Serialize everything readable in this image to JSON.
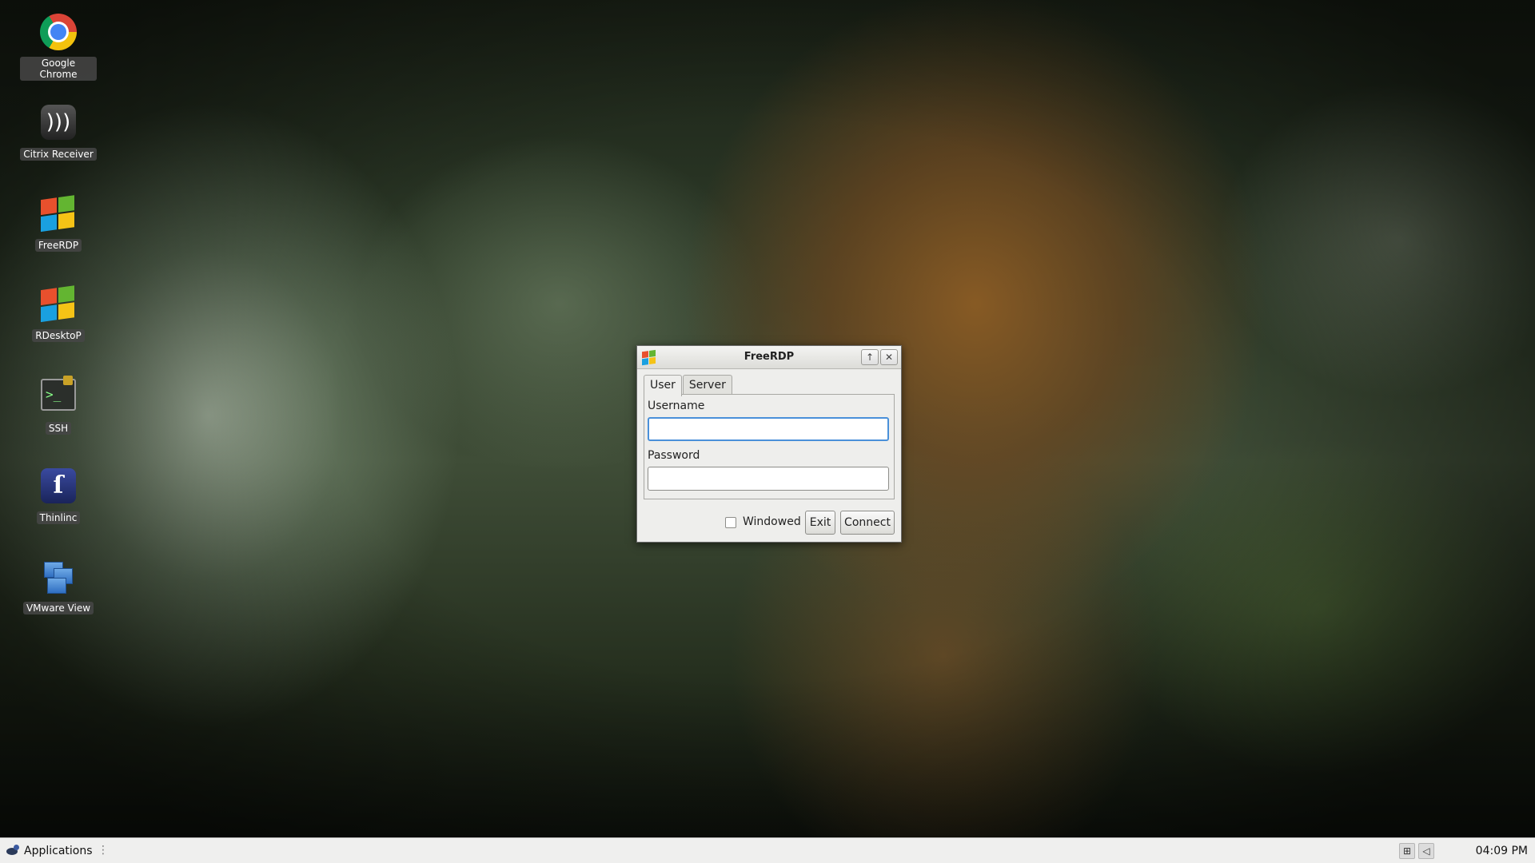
{
  "desktop": {
    "icons": [
      {
        "label": "Google Chrome",
        "icon": "chrome-icon"
      },
      {
        "label": "Citrix Receiver",
        "icon": "citrix-icon"
      },
      {
        "label": "FreeRDP",
        "icon": "windows-flag-icon"
      },
      {
        "label": "RDesktoP",
        "icon": "windows-flag-icon"
      },
      {
        "label": "SSH",
        "icon": "terminal-lock-icon"
      },
      {
        "label": "Thinlinc",
        "icon": "thinlinc-icon"
      },
      {
        "label": "VMware View",
        "icon": "vmware-icon"
      }
    ]
  },
  "dialog": {
    "title": "FreeRDP",
    "title_icon": "windows-flag-icon",
    "tabs": [
      {
        "label": "User",
        "active": true
      },
      {
        "label": "Server",
        "active": false
      }
    ],
    "username_label": "Username",
    "username_value": "",
    "password_label": "Password",
    "password_value": "",
    "windowed_label": "Windowed",
    "windowed_checked": false,
    "exit_label": "Exit",
    "connect_label": "Connect",
    "maximize_glyph": "↑",
    "close_glyph": "✕"
  },
  "taskbar": {
    "applications_label": "Applications",
    "separator_glyph": "⋮",
    "tray_icons": [
      "network-icon",
      "volume-icon"
    ],
    "clock": "04:09 PM"
  },
  "colors": {
    "focus_border": "#4a90d9",
    "icon_label_bg": "#464646",
    "taskbar_bg": "#efefee"
  }
}
